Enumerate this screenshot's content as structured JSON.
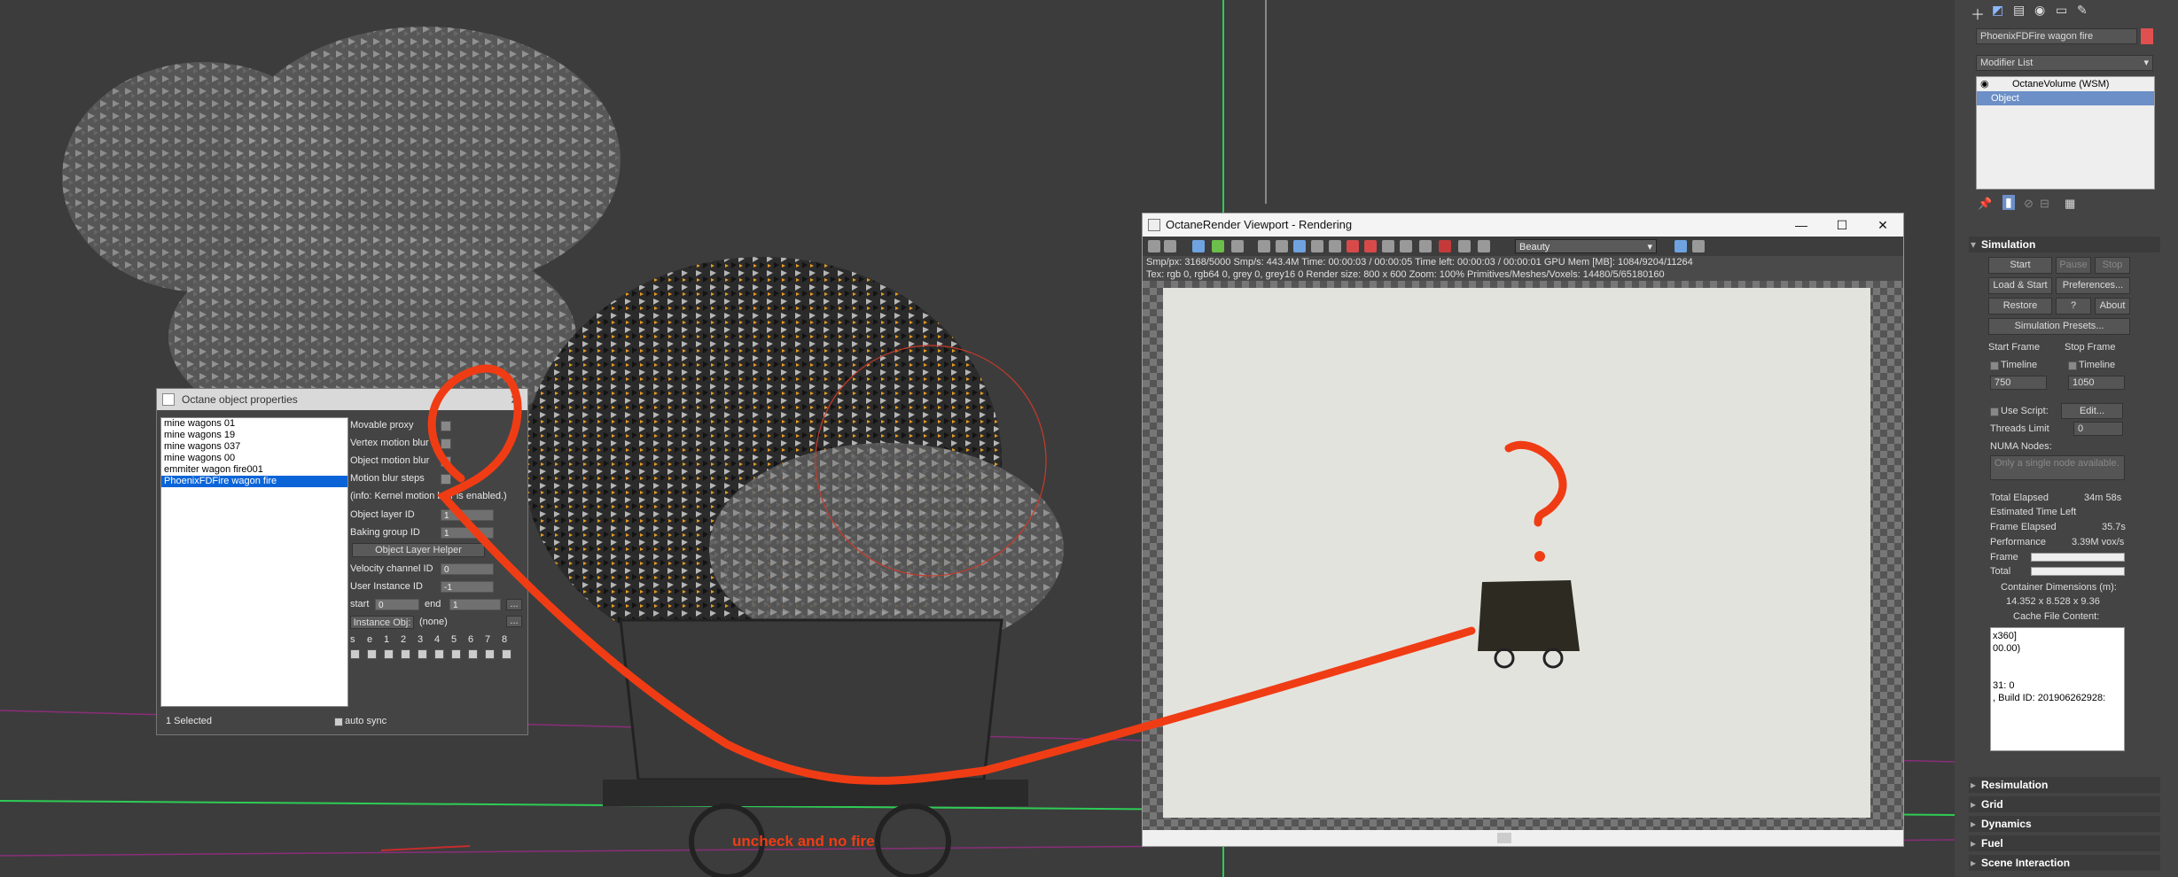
{
  "objprops": {
    "title": "Octane object properties",
    "objects": [
      "mine wagons 01",
      "mine wagons 19",
      "mine wagons 037",
      "mine wagons 00",
      "emmiter wagon fire001",
      "PhoenixFDFire wagon fire"
    ],
    "selected_index": 5,
    "movable_proxy": "Movable proxy",
    "vertex_motion_blur": "Vertex motion blur",
    "object_motion_blur": "Object motion blur",
    "motion_blur_steps": "Motion blur steps",
    "info": "(info: Kernel motion blur is enabled.)",
    "object_layer_id": "Object layer ID",
    "object_layer_id_val": "1",
    "baking_group_id": "Baking group ID",
    "baking_group_id_val": "1",
    "object_layer_helper": "Object Layer Helper",
    "velocity_channel_id": "Velocity channel ID",
    "velocity_channel_id_val": "0",
    "user_instance_id": "User Instance ID",
    "user_instance_id_val": "-1",
    "start": "start",
    "start_val": "0",
    "end": "end",
    "end_val": "1",
    "dots": "...",
    "instance_obj": "Instance Obj:",
    "none": "(none)",
    "flags": [
      "s",
      "e",
      "1",
      "2",
      "3",
      "4",
      "5",
      "6",
      "7",
      "8"
    ],
    "selected_count": "1 Selected",
    "auto_sync": "auto sync"
  },
  "render": {
    "title": "OctaneRender Viewport - Rendering",
    "pass": "Beauty",
    "stats_line1": "Smp/px: 3168/5000    Smp/s: 443.4M    Time: 00:00:03 / 00:00:05    Time left: 00:00:03 / 00:00:01    GPU Mem [MB]: 1084/9204/11264",
    "stats_line2": "Tex: rgb 0, rgb64 0, grey 0, grey16 0    Render size: 800 x 600    Zoom: 100%    Primitives/Meshes/Voxels: 14480/5/65180160"
  },
  "panel": {
    "object_name": "PhoenixFDFire wagon fire",
    "modifier_list": "Modifier List",
    "modifiers": [
      "OctaneVolume (WSM)",
      "Object"
    ],
    "simulation": "Simulation",
    "start": "Start",
    "pause": "Pause",
    "stop": "Stop",
    "load_start": "Load & Start",
    "preferences": "Preferences...",
    "restore": "Restore",
    "question": "?",
    "about": "About",
    "presets": "Simulation Presets...",
    "start_frame": "Start Frame",
    "stop_frame": "Stop Frame",
    "timeline": "Timeline",
    "start_frame_val": "750",
    "stop_frame_val": "1050",
    "use_script": "Use Script:",
    "edit": "Edit...",
    "threads_limit": "Threads Limit",
    "threads_val": "0",
    "numa_nodes": "NUMA Nodes:",
    "numa_info": "Only a single node available.",
    "total_elapsed": "Total Elapsed",
    "total_elapsed_val": "34m 58s",
    "estimated": "Estimated Time Left",
    "frame_elapsed": "Frame Elapsed",
    "frame_elapsed_val": "35.7s",
    "performance": "Performance",
    "performance_val": "3.39M vox/s",
    "frame": "Frame",
    "total": "Total",
    "container_dims": "Container Dimensions (m):",
    "container_dims_val": "14.352 x 8.528 x 9.36",
    "cache_content": "Cache File Content:",
    "cache_lines": [
      "x360]",
      "00.00)",
      "",
      "",
      "31: 0",
      ", Build ID: 201906262928:"
    ],
    "sections": [
      "Resimulation",
      "Grid",
      "Dynamics",
      "Fuel",
      "Scene Interaction"
    ]
  },
  "annotation": {
    "caption": "uncheck and no fire",
    "color": "#f03c14"
  }
}
